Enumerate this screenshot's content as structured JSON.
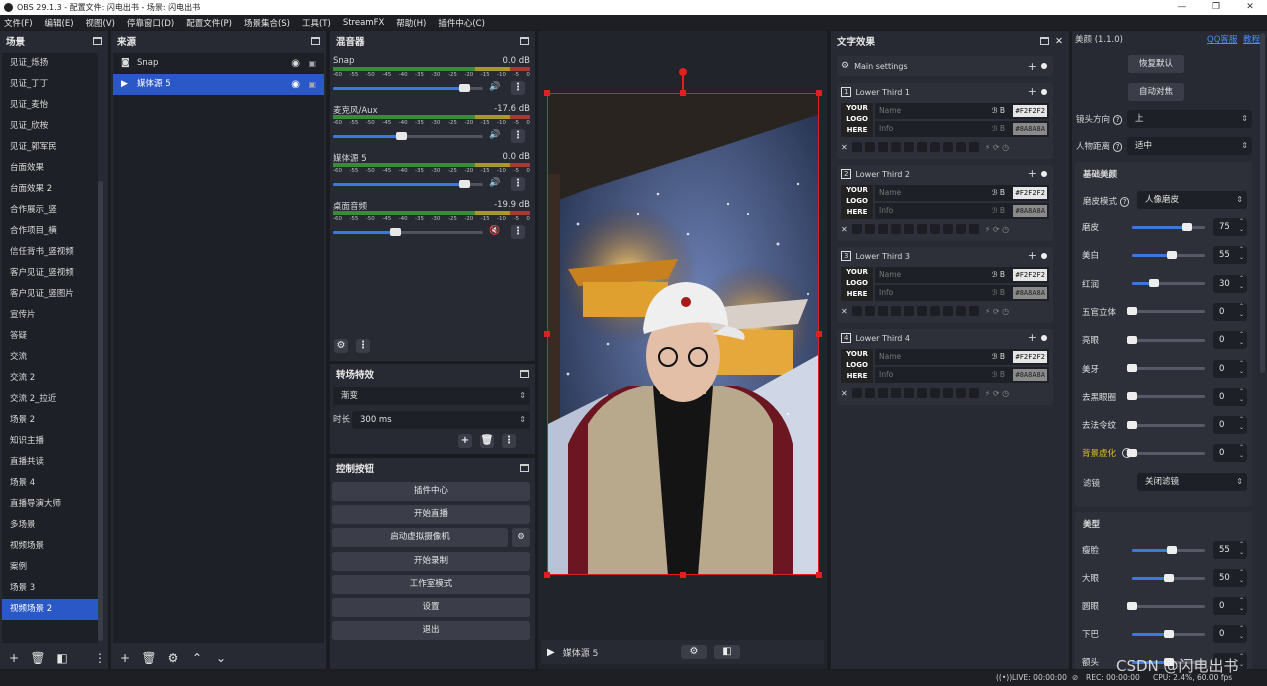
{
  "window": {
    "title": "OBS 29.1.3 - 配置文件: 闪电出书 - 场景: 闪电出书",
    "min": "—",
    "max": "❐",
    "close": "✕"
  },
  "menu": [
    "文件(F)",
    "编辑(E)",
    "视图(V)",
    "停靠窗口(D)",
    "配置文件(P)",
    "场景集合(S)",
    "工具(T)",
    "StreamFX",
    "帮助(H)",
    "插件中心(C)"
  ],
  "scenes": {
    "title": "场景",
    "items": [
      "见证_烁扬",
      "见证_丁丁",
      "见证_麦怡",
      "见证_欣桉",
      "见证_郭军民",
      "台面效果",
      "台面效果 2",
      "合作展示_竖",
      "合作项目_横",
      "信任背书_竖视频",
      "客户见证_竖视频",
      "客户见证_竖图片",
      "宣传片",
      "答疑",
      "交流",
      "交流 2",
      "交流 2_拉近",
      "场景 2",
      "知识主播",
      "直播共读",
      "场景 4",
      "直播导演大师",
      "多场景",
      "视频场景",
      "案例",
      "场景 3",
      "视频场景 2"
    ],
    "selected_index": 26
  },
  "sources": {
    "title": "来源",
    "items": [
      {
        "name": "Snap",
        "icon": "camera-icon"
      },
      {
        "name": "媒体源 5",
        "icon": "play-icon"
      }
    ],
    "selected_index": 1
  },
  "mixer": {
    "title": "混音器",
    "scale": [
      "-60",
      "-55",
      "-50",
      "-45",
      "-40",
      "-35",
      "-30",
      "-25",
      "-20",
      "-15",
      "-10",
      "-5",
      "0"
    ],
    "channels": [
      {
        "name": "Snap",
        "db": "0.0 dB",
        "level": 0.88,
        "muted": false
      },
      {
        "name": "麦克风/Aux",
        "db": "-17.6 dB",
        "level": 0.46,
        "muted": false
      },
      {
        "name": "媒体源 5",
        "db": "0.0 dB",
        "level": 0.88,
        "muted": false
      },
      {
        "name": "桌面音频",
        "db": "-19.9 dB",
        "level": 0.42,
        "muted": true
      }
    ]
  },
  "transitions": {
    "title": "转场特效",
    "type": "渐变",
    "duration_label": "时长",
    "duration": "300 ms"
  },
  "controls": {
    "title": "控制按钮",
    "buttons": [
      "插件中心",
      "开始直播",
      "启动虚拟摄像机",
      "开始录制",
      "工作室模式",
      "设置",
      "退出"
    ]
  },
  "preview": {
    "source_name": "媒体源 5"
  },
  "text_effects": {
    "title": "文字效果",
    "main_settings": "Main settings",
    "lower_thirds": [
      {
        "index": "1",
        "title": "Lower Third 1",
        "name_ph": "Name",
        "info_ph": "Info",
        "color1": "#F2F2F2",
        "color2": "#8A8A8A"
      },
      {
        "index": "2",
        "title": "Lower Third 2",
        "name_ph": "Name",
        "info_ph": "Info",
        "color1": "#F2F2F2",
        "color2": "#8A8A8A"
      },
      {
        "index": "3",
        "title": "Lower Third 3",
        "name_ph": "Name",
        "info_ph": "Info",
        "color1": "#F2F2F2",
        "color2": "#8A8A8A"
      },
      {
        "index": "4",
        "title": "Lower Third 4",
        "name_ph": "Name",
        "info_ph": "Info",
        "color1": "#F2F2F2",
        "color2": "#8A8A8A"
      }
    ],
    "logo": [
      "YOUR",
      "LOGO",
      "HERE"
    ]
  },
  "beauty": {
    "title": "美颜 (1.1.0)",
    "links": [
      "QQ客服",
      "教程"
    ],
    "reset": "恢复默认",
    "auto_align": "自动对焦",
    "camera_dir_label": "镜头方向",
    "camera_dir": "上",
    "distance_label": "人物距离",
    "distance": "适中",
    "basic_title": "基础美颜",
    "smooth_mode_label": "磨皮模式",
    "smooth_mode": "人像磨皮",
    "basic_sliders": [
      {
        "label": "磨皮",
        "value": "75",
        "frac": 0.75
      },
      {
        "label": "美白",
        "value": "55",
        "frac": 0.55
      },
      {
        "label": "红润",
        "value": "30",
        "frac": 0.3
      },
      {
        "label": "五官立体",
        "value": "0",
        "frac": 0.0
      },
      {
        "label": "亮眼",
        "value": "0",
        "frac": 0.0
      },
      {
        "label": "美牙",
        "value": "0",
        "frac": 0.0
      },
      {
        "label": "去黑眼圈",
        "value": "0",
        "frac": 0.0
      },
      {
        "label": "去法令纹",
        "value": "0",
        "frac": 0.0
      },
      {
        "label": "背景虚化",
        "value": "0",
        "frac": 0.0
      }
    ],
    "filter_label": "滤镜",
    "filter": "关闭滤镜",
    "shape_title": "美型",
    "shape_sliders": [
      {
        "label": "瘦脸",
        "value": "55",
        "frac": 0.55
      },
      {
        "label": "大眼",
        "value": "50",
        "frac": 0.5
      },
      {
        "label": "圆眼",
        "value": "0",
        "frac": 0.0
      },
      {
        "label": "下巴",
        "value": "0",
        "frac": 0.5
      },
      {
        "label": "额头",
        "value": "",
        "frac": 0.5
      }
    ]
  },
  "status": {
    "live": "LIVE: 00:00:00",
    "rec": "REC: 00:00:00",
    "cpu": "CPU: 2.4%, 60.00 fps"
  },
  "watermark": "CSDN @闪电出书"
}
